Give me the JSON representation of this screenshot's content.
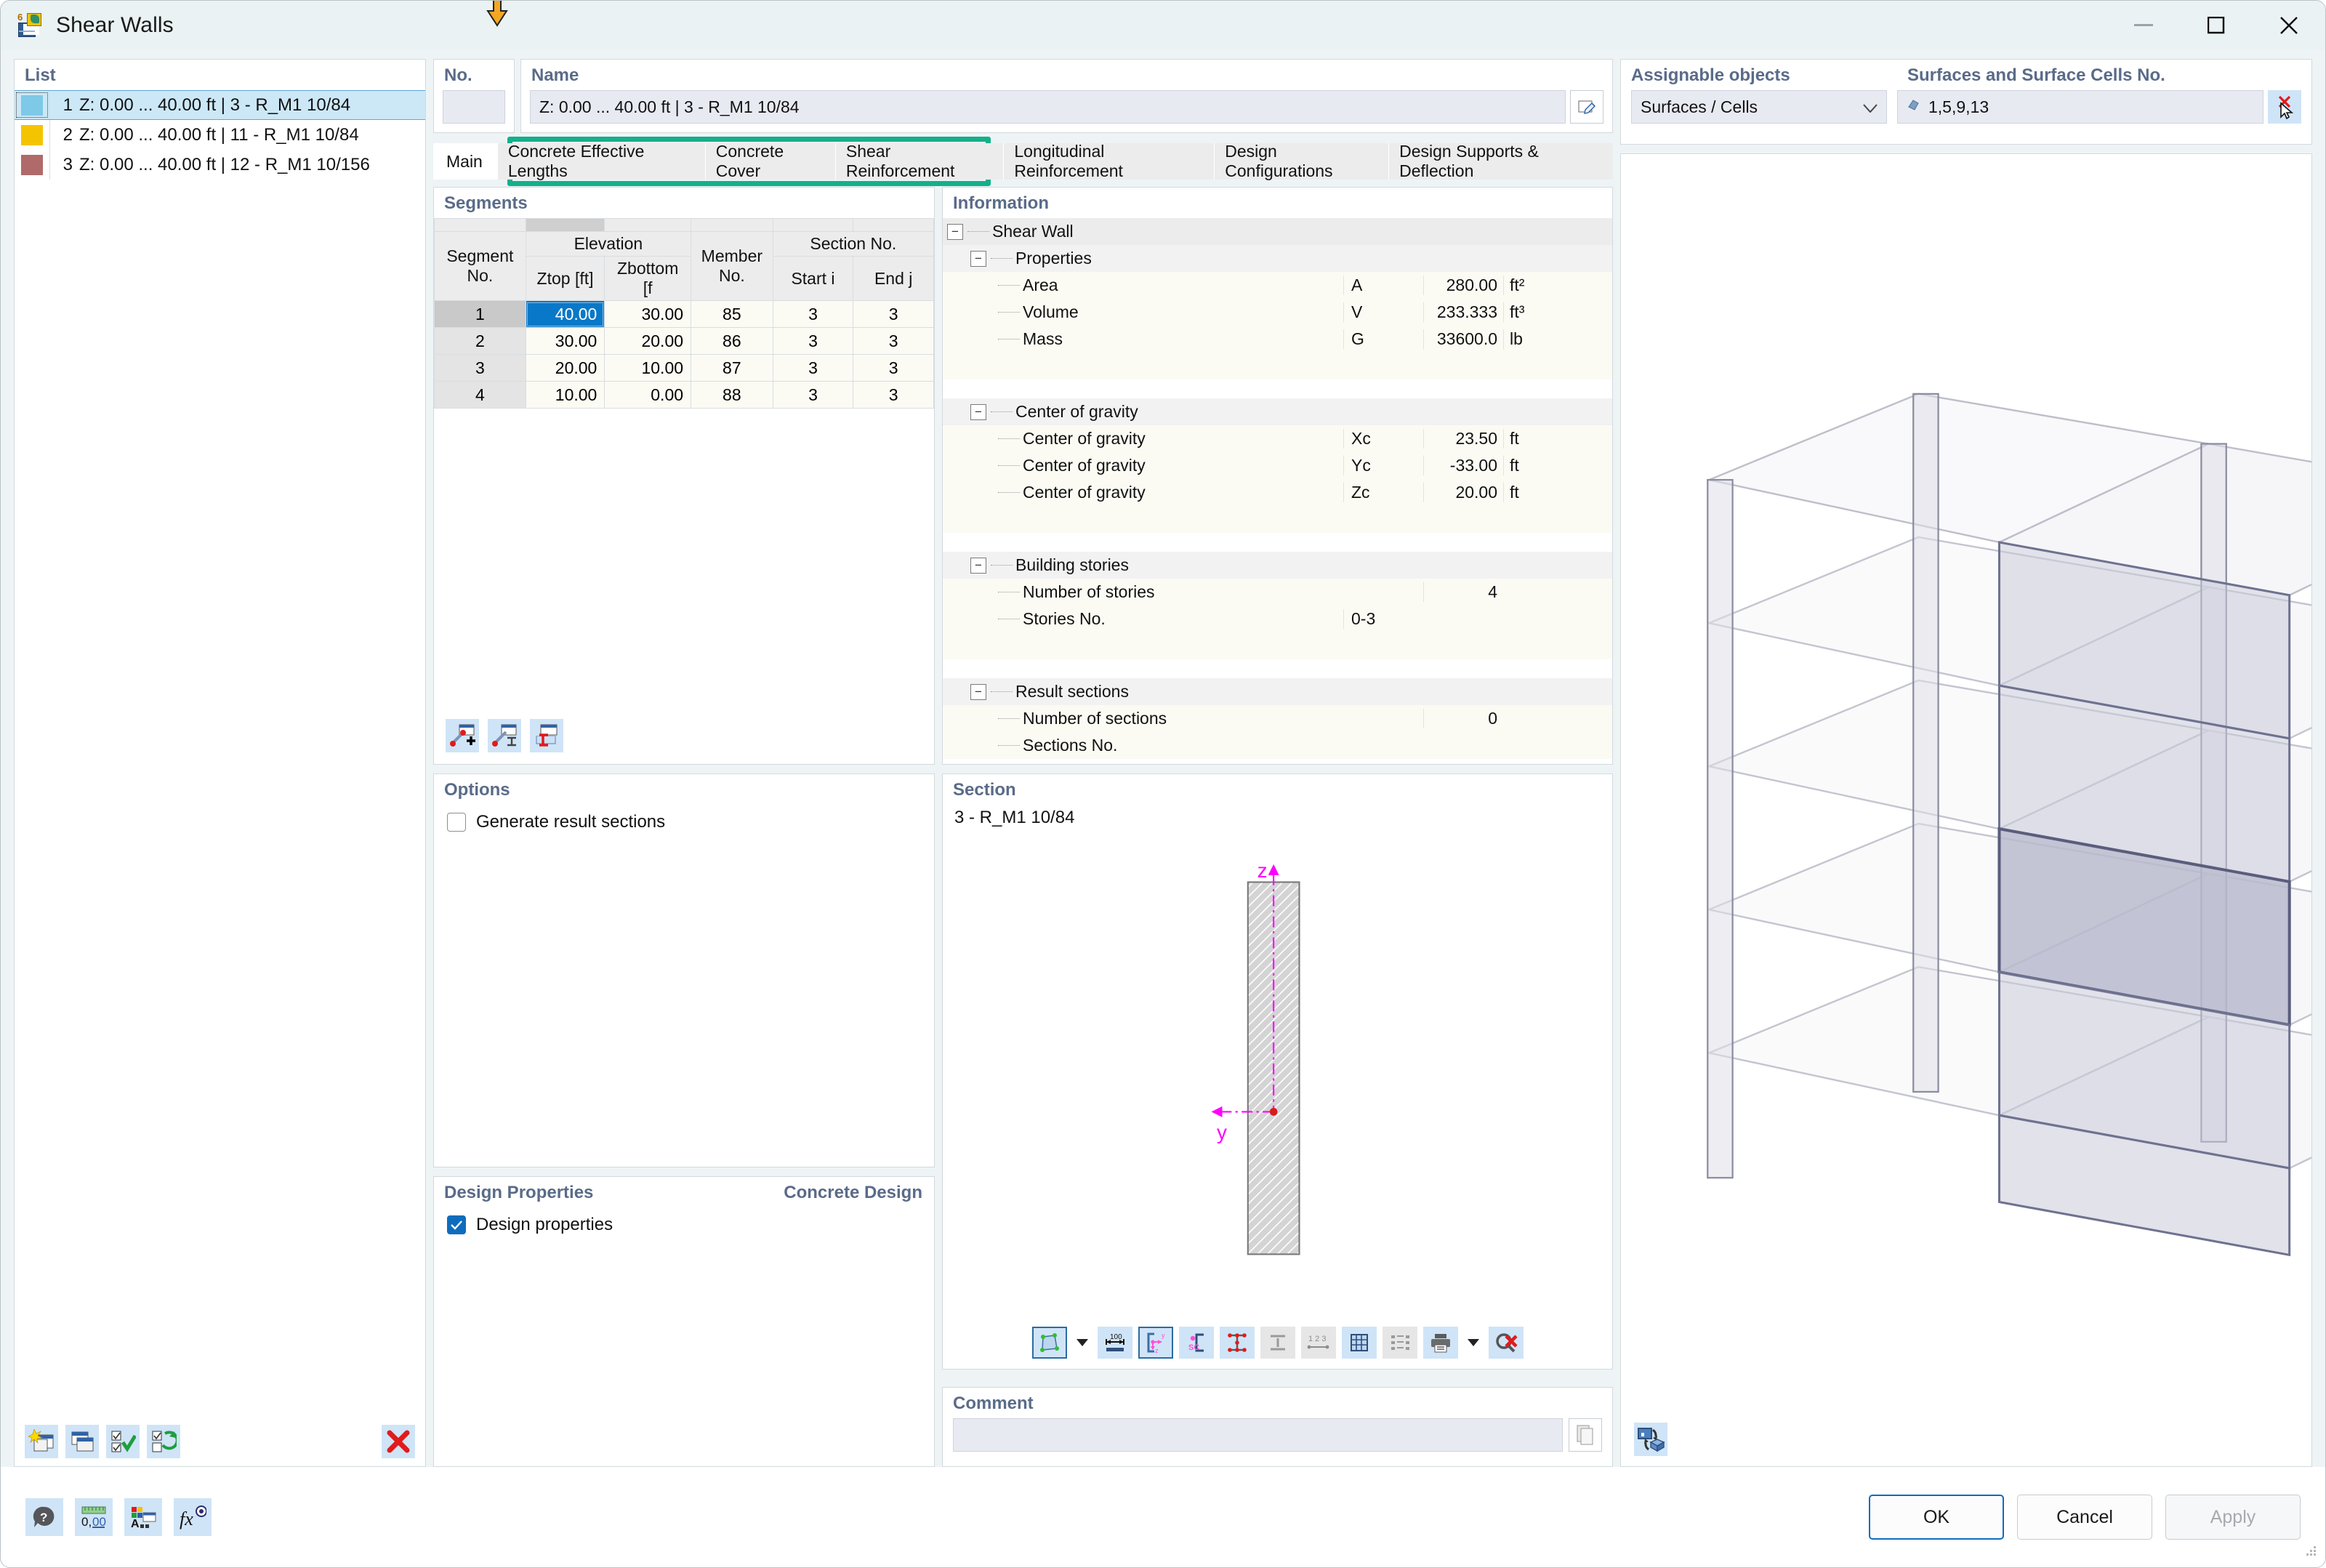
{
  "window": {
    "title": "Shear Walls",
    "icon": "shear-wall-icon",
    "minimize": "minimize-icon",
    "maximize": "maximize-icon",
    "close": "close-icon"
  },
  "list": {
    "title": "List",
    "items": [
      {
        "index": "1",
        "label": "Z: 0.00 ... 40.00 ft | 3 - R_M1 10/84",
        "color": "#7ec8e8",
        "selected": true
      },
      {
        "index": "2",
        "label": "Z: 0.00 ... 40.00 ft | 11 - R_M1 10/84",
        "color": "#f5c400",
        "selected": false
      },
      {
        "index": "3",
        "label": "Z: 0.00 ... 40.00 ft | 12 - R_M1 10/156",
        "color": "#b06a6a",
        "selected": false
      }
    ],
    "toolbar": [
      {
        "name": "new-shear-wall-icon",
        "title": "New"
      },
      {
        "name": "copy-shear-wall-icon",
        "title": "Copy"
      },
      {
        "name": "select-all-icon",
        "title": "Select all"
      },
      {
        "name": "invert-selection-icon",
        "title": "Invert selection"
      },
      {
        "name": "delete-icon",
        "title": "Delete"
      }
    ]
  },
  "no_field": {
    "label": "No.",
    "value": ""
  },
  "name_field": {
    "label": "Name",
    "value": "Z: 0.00 ... 40.00  ft | 3 - R_M1 10/84",
    "edit_icon": "edit-name-icon"
  },
  "assignable": {
    "label": "Assignable objects",
    "selected": "Surfaces / Cells",
    "options": [
      "Surfaces / Cells"
    ],
    "dropdown_icon": "chevron-down-icon"
  },
  "surfaces": {
    "label": "Surfaces and Surface Cells No.",
    "value": "1,5,9,13",
    "prefix_icon": "surface-pick-icon",
    "pick_icon": "cursor-pick-icon"
  },
  "tabs": {
    "items": [
      {
        "label": "Main",
        "active": true
      },
      {
        "label": "Concrete Effective Lengths",
        "active": false
      },
      {
        "label": "Concrete Cover",
        "active": false
      },
      {
        "label": "Shear Reinforcement",
        "active": false
      },
      {
        "label": "Longitudinal Reinforcement",
        "active": false
      },
      {
        "label": "Design Configurations",
        "active": false
      },
      {
        "label": "Design Supports & Deflection",
        "active": false
      }
    ],
    "highlight_color": "#14b08a"
  },
  "segments": {
    "title": "Segments",
    "headers_top": [
      "Segment",
      "Elevation",
      "Member",
      "Section No."
    ],
    "headers": [
      "Segment No.",
      "Ztop [ft]",
      "Zbottom [f",
      "Member No.",
      "Start i",
      "End j"
    ],
    "header_group_segment": "Segment",
    "header_group_elevation": "Elevation",
    "header_group_member": "Member",
    "header_group_section": "Section No.",
    "h_segment_no": "No.",
    "h_ztop": "Ztop [ft]",
    "h_zbottom": "Zbottom [f",
    "h_member_no": "No.",
    "h_start": "Start i",
    "h_end": "End j",
    "rows": [
      {
        "no": "1",
        "ztop": "40.00",
        "zbottom": "30.00",
        "member": "85",
        "start": "3",
        "end": "3",
        "selected_cell": "ztop"
      },
      {
        "no": "2",
        "ztop": "30.00",
        "zbottom": "20.00",
        "member": "86",
        "start": "3",
        "end": "3",
        "selected_cell": ""
      },
      {
        "no": "3",
        "ztop": "20.00",
        "zbottom": "10.00",
        "member": "87",
        "start": "3",
        "end": "3",
        "selected_cell": ""
      },
      {
        "no": "4",
        "ztop": "10.00",
        "zbottom": "0.00",
        "member": "88",
        "start": "3",
        "end": "3",
        "selected_cell": ""
      }
    ],
    "toolbar": [
      {
        "name": "add-segment-icon"
      },
      {
        "name": "segment-properties-icon"
      },
      {
        "name": "segment-section-icon"
      }
    ]
  },
  "options": {
    "title": "Options",
    "generate_result_sections": {
      "label": "Generate result sections",
      "checked": false
    }
  },
  "design_properties": {
    "title": "Design Properties",
    "right_label": "Concrete Design",
    "checkbox": {
      "label": "Design properties",
      "checked": true
    }
  },
  "information": {
    "title": "Information",
    "root": "Shear Wall",
    "groups": [
      {
        "name": "Properties",
        "rows": [
          {
            "label": "Area",
            "symbol": "A",
            "value": "280.00",
            "unit": "ft²"
          },
          {
            "label": "Volume",
            "symbol": "V",
            "value": "233.333",
            "unit": "ft³"
          },
          {
            "label": "Mass",
            "symbol": "G",
            "value": "33600.0",
            "unit": "lb"
          }
        ]
      },
      {
        "name": "Center of gravity",
        "rows": [
          {
            "label": "Center of gravity",
            "symbol": "Xc",
            "value": "23.50",
            "unit": "ft"
          },
          {
            "label": "Center of gravity",
            "symbol": "Yc",
            "value": "-33.00",
            "unit": "ft"
          },
          {
            "label": "Center of gravity",
            "symbol": "Zc",
            "value": "20.00",
            "unit": "ft"
          }
        ]
      },
      {
        "name": "Building stories",
        "rows": [
          {
            "label": "Number of stories",
            "symbol": "",
            "value": "4",
            "unit": ""
          },
          {
            "label": "Stories No.",
            "symbol": "0-3",
            "value": "",
            "unit": ""
          }
        ]
      },
      {
        "name": "Result sections",
        "rows": [
          {
            "label": "Number of sections",
            "symbol": "",
            "value": "0",
            "unit": ""
          },
          {
            "label": "Sections No.",
            "symbol": "",
            "value": "",
            "unit": ""
          }
        ]
      }
    ]
  },
  "section": {
    "title": "Section",
    "name": "3 - R_M1 10/84",
    "axis_z": "z",
    "axis_y": "y",
    "axis_color": "#ff00ff",
    "toolbar": [
      {
        "name": "section-shape-icon",
        "state": "selected"
      },
      {
        "name": "dimensions-icon",
        "state": "on"
      },
      {
        "name": "axis-system-icon",
        "state": "selected"
      },
      {
        "name": "shear-center-icon",
        "state": "on"
      },
      {
        "name": "stress-points-icon",
        "state": "on"
      },
      {
        "name": "parts-icon",
        "state": "off"
      },
      {
        "name": "numbering-icon",
        "state": "off"
      },
      {
        "name": "fe-mesh-icon",
        "state": "on"
      },
      {
        "name": "layers-icon",
        "state": "off"
      },
      {
        "name": "print-icon",
        "state": "on"
      },
      {
        "name": "reset-view-icon",
        "state": "on"
      }
    ]
  },
  "comment": {
    "title": "Comment",
    "value": "",
    "dropdown_icon": "chevron-down-icon",
    "copy_icon": "clipboard-icon"
  },
  "view3d": {
    "render_mode_icon": "render-mode-icon"
  },
  "footer": {
    "left_tools": [
      {
        "name": "help-icon"
      },
      {
        "name": "units-decimal-places-icon"
      },
      {
        "name": "display-properties-icon"
      },
      {
        "name": "formula-icon"
      }
    ],
    "buttons": [
      {
        "label": "OK",
        "style": "primary"
      },
      {
        "label": "Cancel",
        "style": "normal"
      },
      {
        "label": "Apply",
        "style": "disabled"
      }
    ]
  }
}
